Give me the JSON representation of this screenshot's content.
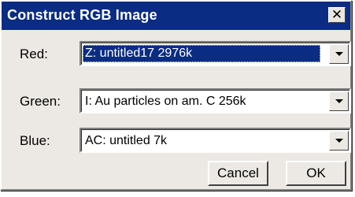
{
  "dialog": {
    "title": "Construct RGB Image",
    "close_label": "✕"
  },
  "fields": [
    {
      "label": "Red:",
      "value": "Z: untitled17  2976k",
      "selected": true
    },
    {
      "label": "Green:",
      "value": "I: Au particles on am. C  256k",
      "selected": false
    },
    {
      "label": "Blue:",
      "value": "AC: untitled  7k",
      "selected": false
    }
  ],
  "buttons": {
    "cancel_label": "Cancel",
    "ok_label": "OK"
  },
  "colors": {
    "titlebar": "#0a2c83",
    "selection": "#0a2c83",
    "dialog_bg": "#ece9e4"
  }
}
